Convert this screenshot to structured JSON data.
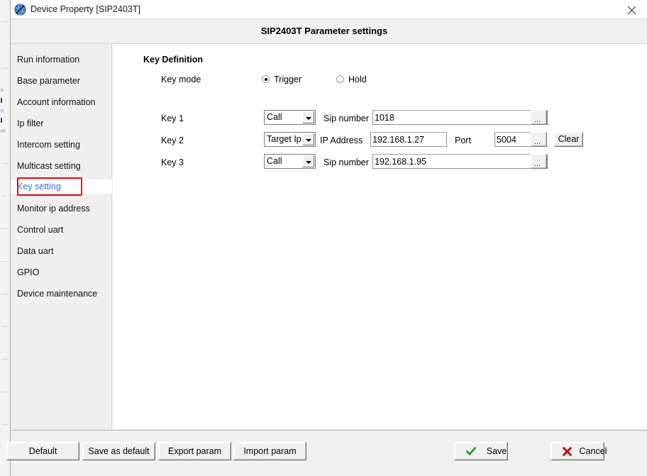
{
  "window": {
    "title": "Device Property [SIP2403T]",
    "icon": "device-globe-tools-icon",
    "close_label": "✕"
  },
  "header": {
    "title": "SIP2403T Parameter settings"
  },
  "sidebar": {
    "items": [
      {
        "label": "Run information",
        "selected": false
      },
      {
        "label": "Base parameter",
        "selected": false
      },
      {
        "label": "Account information",
        "selected": false
      },
      {
        "label": "Ip filter",
        "selected": false
      },
      {
        "label": "Intercom setting",
        "selected": false
      },
      {
        "label": "Multicast setting",
        "selected": false
      },
      {
        "label": "Key setting",
        "selected": true
      },
      {
        "label": "Monitor ip address",
        "selected": false
      },
      {
        "label": "Control uart",
        "selected": false
      },
      {
        "label": "Data uart",
        "selected": false
      },
      {
        "label": "GPIO",
        "selected": false
      },
      {
        "label": "Device maintenance",
        "selected": false
      }
    ],
    "highlight_color": "#ff0000",
    "selected_text_color": "#2f6fdd"
  },
  "main": {
    "section_title": "Key Definition",
    "key_mode": {
      "label": "Key mode",
      "options": [
        {
          "label": "Trigger",
          "checked": true
        },
        {
          "label": "Hold",
          "checked": false
        }
      ]
    },
    "keys": [
      {
        "name": "Key 1",
        "type": "Call",
        "value_label": "Sip number",
        "value": "1018",
        "browse_label": "...",
        "has_port": false,
        "has_clear": false
      },
      {
        "name": "Key 2",
        "type": "Target Ip",
        "value_label": "IP Address",
        "value": "192.168.1.27",
        "browse_label": "...",
        "has_port": true,
        "port_label": "Port",
        "port_value": "5004",
        "has_clear": true,
        "clear_label": "Clear"
      },
      {
        "name": "Key 3",
        "type": "Call",
        "value_label": "Sip number",
        "value": "192.168.1.95",
        "browse_label": "...",
        "has_port": false,
        "has_clear": false
      }
    ]
  },
  "footer": {
    "default_label": "Default",
    "save_as_default_label": "Save as default",
    "export_label": "Export param",
    "import_label": "Import param",
    "save_label": "Save",
    "cancel_label": "Cancel",
    "save_icon_color": "#1a9d1a",
    "cancel_icon_color": "#c00000"
  }
}
